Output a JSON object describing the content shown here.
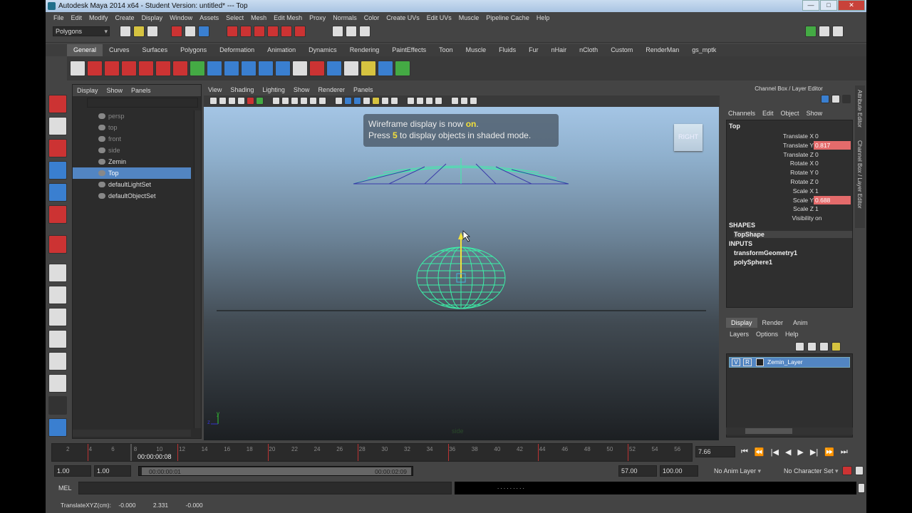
{
  "window": {
    "title": "Autodesk Maya 2014 x64 - Student Version: untitled*   ---   Top",
    "min": "—",
    "max": "□",
    "close": "✕"
  },
  "menus": [
    "File",
    "Edit",
    "Modify",
    "Create",
    "Display",
    "Window",
    "Assets",
    "Select",
    "Mesh",
    "Edit Mesh",
    "Proxy",
    "Normals",
    "Color",
    "Create UVs",
    "Edit UVs",
    "Muscle",
    "Pipeline Cache",
    "Help"
  ],
  "mode_selector": "Polygons",
  "shelf_tabs": [
    "General",
    "Curves",
    "Surfaces",
    "Polygons",
    "Deformation",
    "Animation",
    "Dynamics",
    "Rendering",
    "PaintEffects",
    "Toon",
    "Muscle",
    "Fluids",
    "Fur",
    "nHair",
    "nCloth",
    "Custom",
    "RenderMan",
    "gs_mptk"
  ],
  "shelf_active": "General",
  "outliner": {
    "menu": [
      "Display",
      "Show",
      "Panels"
    ],
    "items": [
      {
        "label": "persp",
        "state": "dim"
      },
      {
        "label": "top",
        "state": "dim"
      },
      {
        "label": "front",
        "state": "dim"
      },
      {
        "label": "side",
        "state": "dim"
      },
      {
        "label": "Zemin",
        "state": "normal"
      },
      {
        "label": "Top",
        "state": "selected"
      },
      {
        "label": "defaultLightSet",
        "state": "normal"
      },
      {
        "label": "defaultObjectSet",
        "state": "normal"
      }
    ]
  },
  "viewport": {
    "menu": [
      "View",
      "Shading",
      "Lighting",
      "Show",
      "Renderer",
      "Panels"
    ],
    "hud_line1_pre": "Wireframe display is now ",
    "hud_line1_key": "on",
    "hud_line1_post": ".",
    "hud_line2_pre": "Press ",
    "hud_line2_key": "5",
    "hud_line2_post": " to display objects in shaded mode.",
    "view_cube": "RIGHT",
    "camera_label": "side",
    "axis_y": "y",
    "axis_z": "z"
  },
  "channel_box": {
    "title": "Channel Box / Layer Editor",
    "menu": [
      "Channels",
      "Edit",
      "Object",
      "Show"
    ],
    "object": "Top",
    "channels": [
      {
        "label": "Translate X",
        "value": "0",
        "keyed": false
      },
      {
        "label": "Translate Y",
        "value": "0.817",
        "keyed": true
      },
      {
        "label": "Translate Z",
        "value": "0",
        "keyed": false
      },
      {
        "label": "Rotate X",
        "value": "0",
        "keyed": false
      },
      {
        "label": "Rotate Y",
        "value": "0",
        "keyed": false
      },
      {
        "label": "Rotate Z",
        "value": "0",
        "keyed": false
      },
      {
        "label": "Scale X",
        "value": "1",
        "keyed": false
      },
      {
        "label": "Scale Y",
        "value": "0.688",
        "keyed": true
      },
      {
        "label": "Scale Z",
        "value": "1",
        "keyed": false
      },
      {
        "label": "Visibility",
        "value": "on",
        "keyed": false
      }
    ],
    "shapes_label": "SHAPES",
    "shape": "TopShape",
    "inputs_label": "INPUTS",
    "inputs": [
      "transformGeometry1",
      "polySphere1"
    ],
    "side_tabs": [
      "Attribute Editor",
      "Channel Box / Layer Editor"
    ]
  },
  "layer_editor": {
    "tabs": [
      "Display",
      "Render",
      "Anim"
    ],
    "active_tab": "Display",
    "menu": [
      "Layers",
      "Options",
      "Help"
    ],
    "layer": {
      "v": "V",
      "r": "R",
      "name": "Zemin_Layer"
    }
  },
  "timeline": {
    "frames": [
      "2",
      "4",
      "6",
      "8",
      "10",
      "12",
      "14",
      "16",
      "18",
      "20",
      "22",
      "24",
      "26",
      "28",
      "30",
      "32",
      "34",
      "36",
      "38",
      "40",
      "42",
      "44",
      "46",
      "48",
      "50",
      "52",
      "54",
      "56"
    ],
    "current_time": "00:00:00:08",
    "current_frame": "7.66",
    "playback": [
      "⏮",
      "⏪",
      "|◀",
      "◀",
      "▶",
      "▶|",
      "⏩",
      "⏭"
    ]
  },
  "range": {
    "start": "1.00",
    "start2": "1.00",
    "range_start_time": "00:00:00:01",
    "range_end_time": "00:00:02:09",
    "end": "57.00",
    "end2": "100.00",
    "anim_layer": "No Anim Layer",
    "character_set": "No Character Set"
  },
  "command": {
    "label": "MEL",
    "output": ". . . . . . . . ."
  },
  "help_line": {
    "label": "TranslateXYZ(cm):",
    "x": "-0.000",
    "y": "2.331",
    "z": "-0.000"
  }
}
